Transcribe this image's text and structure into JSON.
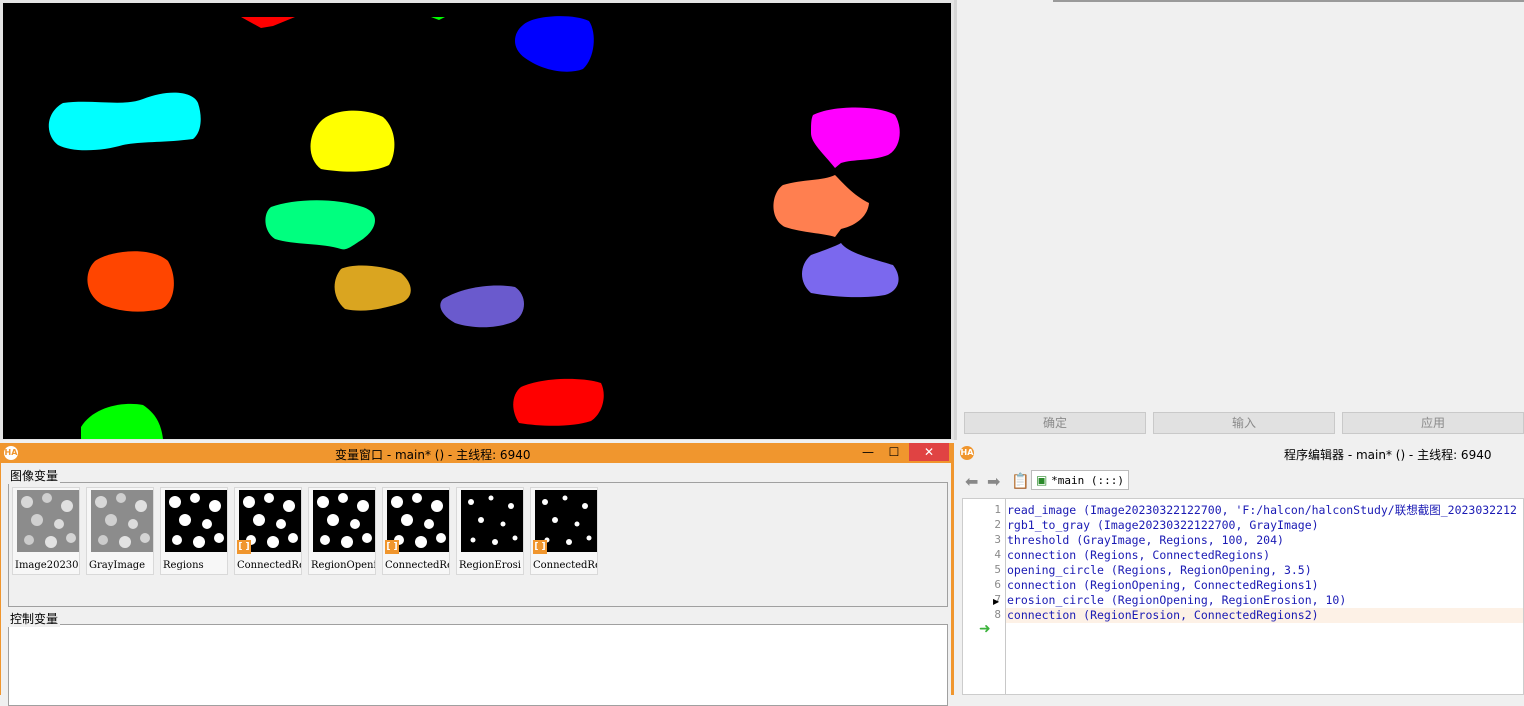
{
  "panel_buttons": [
    "确定",
    "输入",
    "应用"
  ],
  "variable_window": {
    "title": "变量窗口 - main* () - 主线程: 6940",
    "minimize": "—",
    "maximize": "☐",
    "close": "✕",
    "iconic_label": "图像变量",
    "control_label": "控制变量",
    "thumbnails": [
      {
        "label": "Image2023032",
        "tagged": false
      },
      {
        "label": "GrayImage",
        "tagged": false
      },
      {
        "label": "Regions",
        "tagged": false
      },
      {
        "label": "ConnectedRe",
        "tagged": true
      },
      {
        "label": "RegionOpeni",
        "tagged": false
      },
      {
        "label": "ConnectedRe",
        "tagged": true
      },
      {
        "label": "RegionErosi",
        "tagged": false
      },
      {
        "label": "ConnectedRe",
        "tagged": true
      }
    ]
  },
  "program_editor": {
    "title": "程序编辑器 - main* () - 主线程: 6940",
    "procedure_tab": "*main (:::)",
    "lines": [
      {
        "num": "1",
        "code": "read_image (Image20230322122700, 'F:/halcon/halconStudy/联想截图_2023032212"
      },
      {
        "num": "2",
        "code": "rgb1_to_gray (Image20230322122700, GrayImage)"
      },
      {
        "num": "3",
        "code": "threshold (GrayImage, Regions, 100, 204)"
      },
      {
        "num": "4",
        "code": "connection (Regions, ConnectedRegions)"
      },
      {
        "num": "5",
        "code": "opening_circle (Regions, RegionOpening, 3.5)"
      },
      {
        "num": "6",
        "code": "connection (RegionOpening, ConnectedRegions1)"
      },
      {
        "num": "7",
        "code": "erosion_circle (RegionOpening, RegionErosion, 10)"
      },
      {
        "num": "8",
        "code": "connection (RegionErosion, ConnectedRegions2)"
      }
    ],
    "current_line": 8
  },
  "region_colors": [
    "#ff0000",
    "#00ff00",
    "#0000ff",
    "#00ffff",
    "#ffff00",
    "#00ff7f",
    "#ff4500",
    "#daa520",
    "#6a5acd",
    "#ff0000",
    "#00ff00",
    "#ff00ff",
    "#ff7f50",
    "#7b68ee"
  ]
}
